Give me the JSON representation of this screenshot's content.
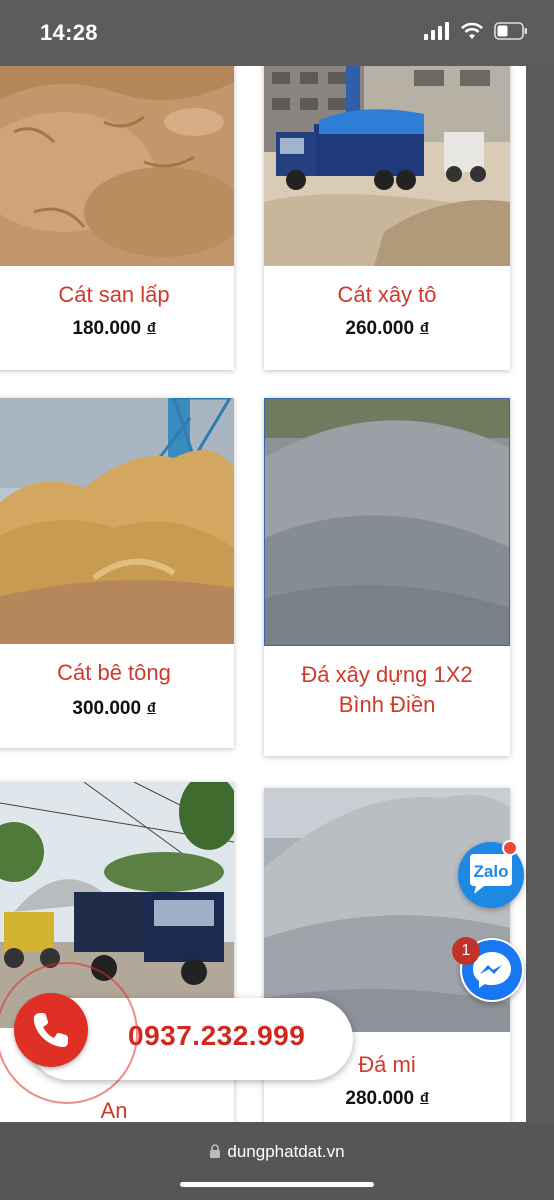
{
  "status_bar": {
    "time": "14:28"
  },
  "products": [
    {
      "name": "Cát san lấp",
      "price": "180.000",
      "currency": "đ"
    },
    {
      "name": "Cát xây tô",
      "price": "260.000",
      "currency": "đ"
    },
    {
      "name": "Cát bê tông",
      "price": "300.000",
      "currency": "đ"
    },
    {
      "name_line1": "Đá xây dựng 1X2",
      "name_line2": "Bình Điền"
    },
    {
      "name_partial": "An"
    },
    {
      "name": "Đá mi",
      "price": "280.000",
      "currency": "đ"
    }
  ],
  "call_widget": {
    "phone": "0937.232.999"
  },
  "zalo": {
    "label": "Zalo"
  },
  "messenger": {
    "badge_count": "1"
  },
  "browser": {
    "url": "dungphatdat.vn"
  },
  "colors": {
    "accent_red": "#d03a2a",
    "zalo_blue": "#1e88e5",
    "messenger_blue": "#1877f2"
  }
}
